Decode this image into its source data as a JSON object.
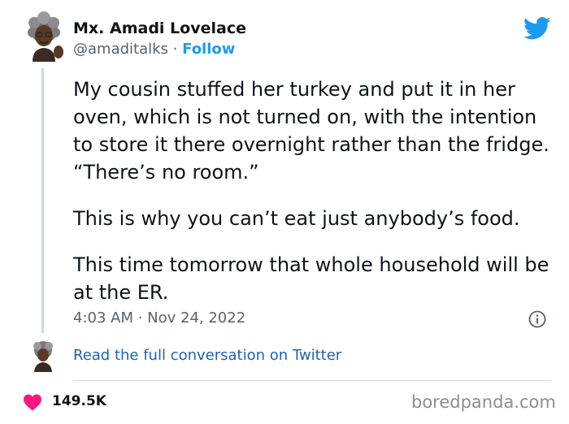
{
  "author": {
    "display_name": "Mx. Amadi Lovelace",
    "handle": "@amaditalks",
    "separator": "·",
    "follow_label": "Follow",
    "avatar_icon": "person-avatar-icon"
  },
  "tweet": {
    "paragraphs": [
      "My cousin stuffed her turkey and put it in her oven, which is not turned on, with the intention to store it there overnight rather than the fridge. “There’s no room.”",
      "This is why you can’t eat just anybody’s food.",
      "This time tomorrow that whole household will be at the ER."
    ],
    "timestamp": "4:03 AM · Nov 24, 2022"
  },
  "footer": {
    "read_link": "Read the full conversation on Twitter",
    "likes": "149.5K",
    "watermark": "boredpanda.com"
  },
  "colors": {
    "accent": "#1d9bf0",
    "link": "#1d64b3",
    "heart": "#f91880",
    "muted": "#536471",
    "text": "#0f1419"
  },
  "icons": [
    "twitter-bird-icon",
    "info-icon",
    "heart-icon"
  ]
}
